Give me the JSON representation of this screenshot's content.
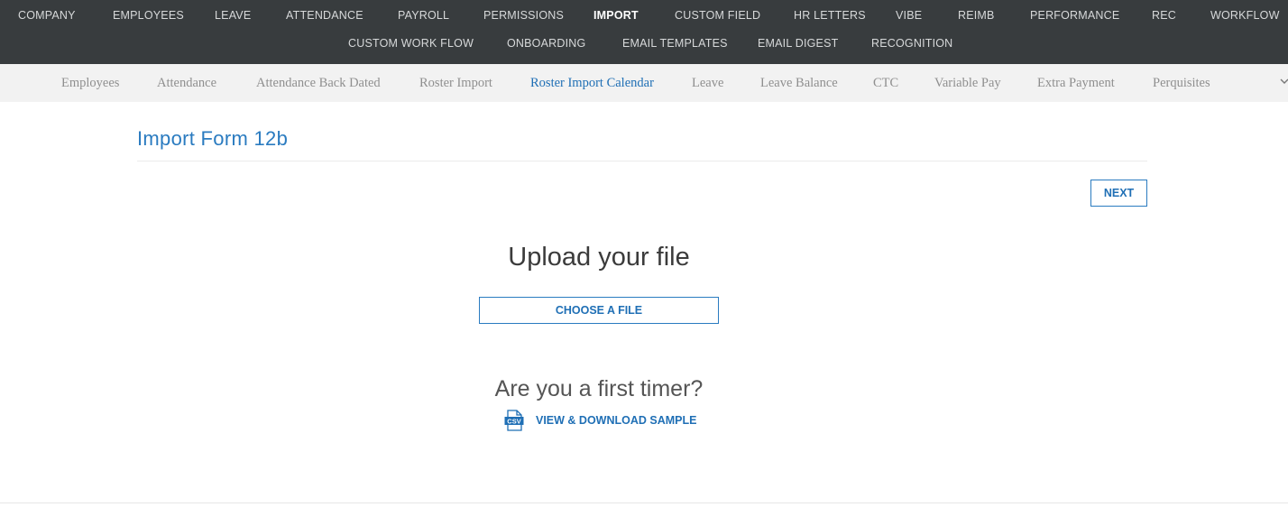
{
  "top_nav": {
    "row1": [
      "COMPANY",
      "EMPLOYEES",
      "LEAVE",
      "ATTENDANCE",
      "PAYROLL",
      "PERMISSIONS",
      "IMPORT",
      "CUSTOM FIELD",
      "HR LETTERS",
      "VIBE",
      "REIMB",
      "PERFORMANCE",
      "REC",
      "WORKFLOW"
    ],
    "row2": [
      "CUSTOM WORK FLOW",
      "ONBOARDING",
      "EMAIL TEMPLATES",
      "EMAIL DIGEST",
      "RECOGNITION"
    ],
    "active": "IMPORT"
  },
  "sub_nav": {
    "items": [
      "Employees",
      "Attendance",
      "Attendance Back Dated",
      "Roster Import",
      "Roster Import Calendar",
      "Leave",
      "Leave Balance",
      "CTC",
      "Variable Pay",
      "Extra Payment",
      "Perquisites"
    ],
    "active": "Roster Import Calendar",
    "more_icon": "chevron-down-icon"
  },
  "page": {
    "title": "Import Form 12b",
    "next_label": "NEXT",
    "upload_heading": "Upload your file",
    "choose_file_label": "CHOOSE A FILE",
    "first_timer_text": "Are you a first timer?",
    "sample_link_label": "VIEW & DOWNLOAD SAMPLE",
    "sample_icon": "csv-file-icon",
    "sample_icon_text": "CSV"
  },
  "colors": {
    "top_nav_bg": "#383c3e",
    "sub_nav_bg": "#f2f2f2",
    "accent": "#1f6fb5"
  }
}
